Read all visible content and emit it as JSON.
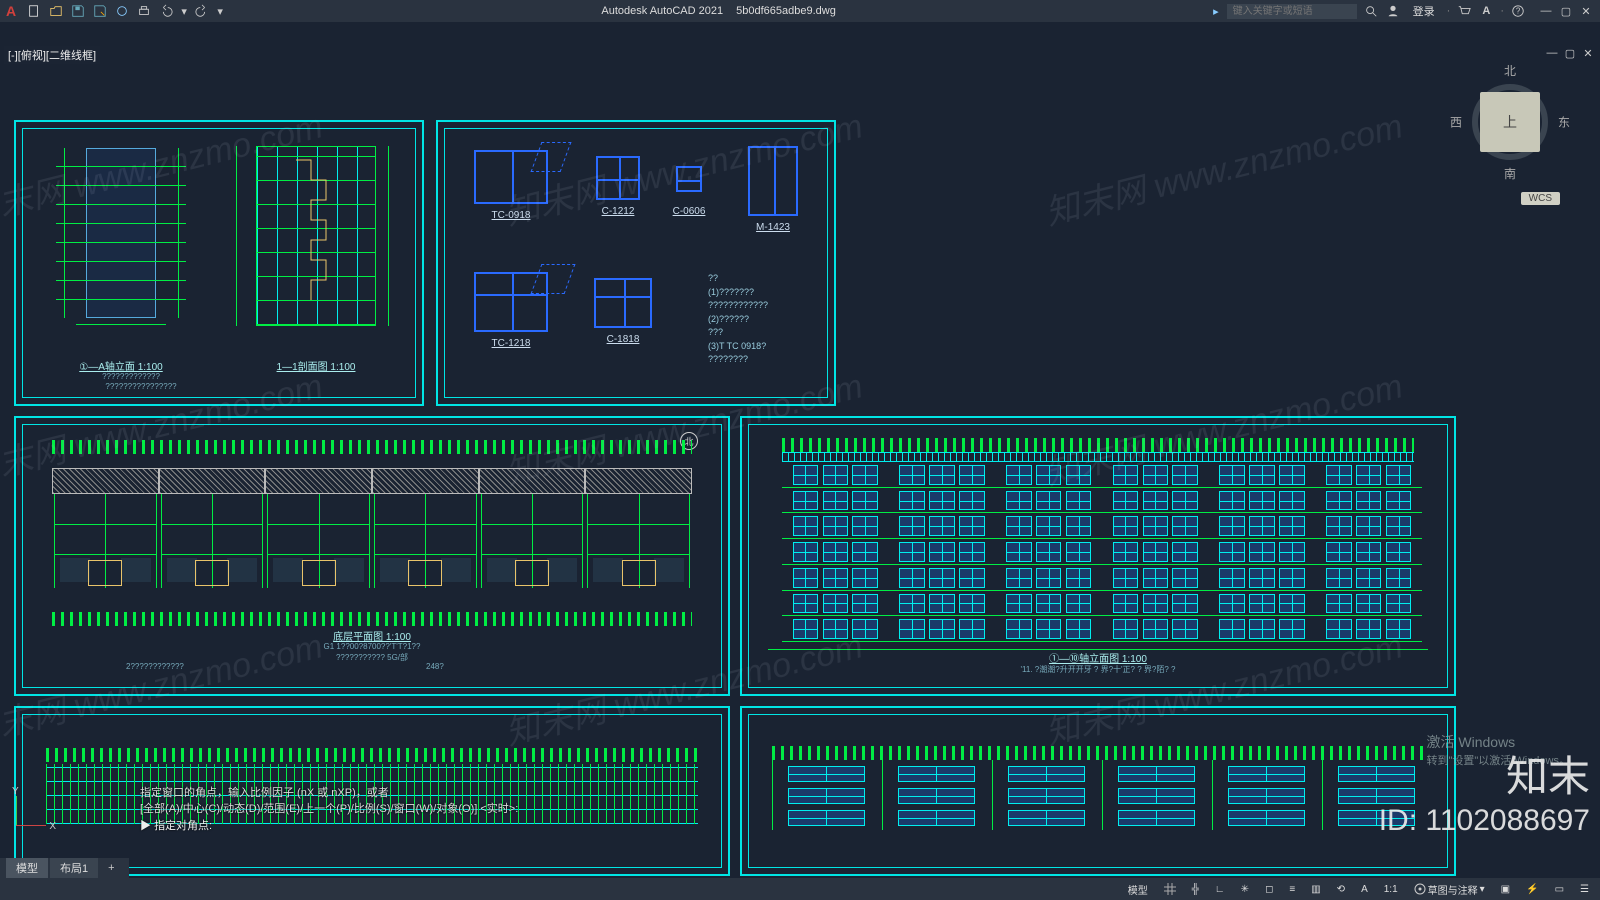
{
  "title": {
    "app": "Autodesk AutoCAD 2021",
    "file": "5b0df665adbe9.dwg"
  },
  "search": {
    "placeholder": "键入关键字或短语"
  },
  "login": "登录",
  "viewport_label": "[-][俯视][二维线框]",
  "viewcube": {
    "n": "北",
    "s": "南",
    "w": "西",
    "e": "东",
    "top": "上",
    "wcs": "WCS"
  },
  "frame1": {
    "left_label": "①—A轴立面 1:100",
    "left_sub1": "?????????????",
    "left_sub2": "????????????????",
    "right_label": "1—1剖面图 1:100"
  },
  "schedule": {
    "items": [
      {
        "name": "TC-0918"
      },
      {
        "name": "C-1212"
      },
      {
        "name": "C-0606"
      },
      {
        "name": "M-1423"
      },
      {
        "name": "TC-1218"
      },
      {
        "name": "C-1818"
      }
    ],
    "note1": "??",
    "note2": "(1)???????",
    "note3": "????????????",
    "note4": "(2)??????",
    "note5": "???",
    "note6": "(3)T TC 0918?",
    "note7": "????????"
  },
  "plan": {
    "title": "底层平面图 1:100",
    "sub1": "G1 1??00?8700??'T'T?1??",
    "sub2": "??????????? 5G/部",
    "sub3": "2????????????",
    "sub4": "248?",
    "north": "北"
  },
  "big_elev": {
    "title": "①—⑩轴立面图 1:100",
    "sub": "'11. ?潮潮?升开开牙 ? 界?十'正? ? 界?陌? ?"
  },
  "cmd": {
    "l1": "指定窗口的角点，输入比例因子 (nX 或 nXP)，或者",
    "l2": "[全部(A)/中心(C)/动态(D)/范围(E)/上一个(P)/比例(S)/窗口(W)/对象(O)] <实时>:",
    "l3": "指定对角点:"
  },
  "tabs": {
    "model": "模型",
    "layout1": "布局1"
  },
  "status": {
    "model": "模型",
    "anno": "草图与注释",
    "scale_hint": "1:1"
  },
  "activate": {
    "l1": "激活 Windows",
    "l2": "转到\"设置\"以激活 Windows。"
  },
  "watermark": {
    "text": "知末网 www.znzmo.com",
    "brand": "知末",
    "id": "ID: 1102088697"
  }
}
